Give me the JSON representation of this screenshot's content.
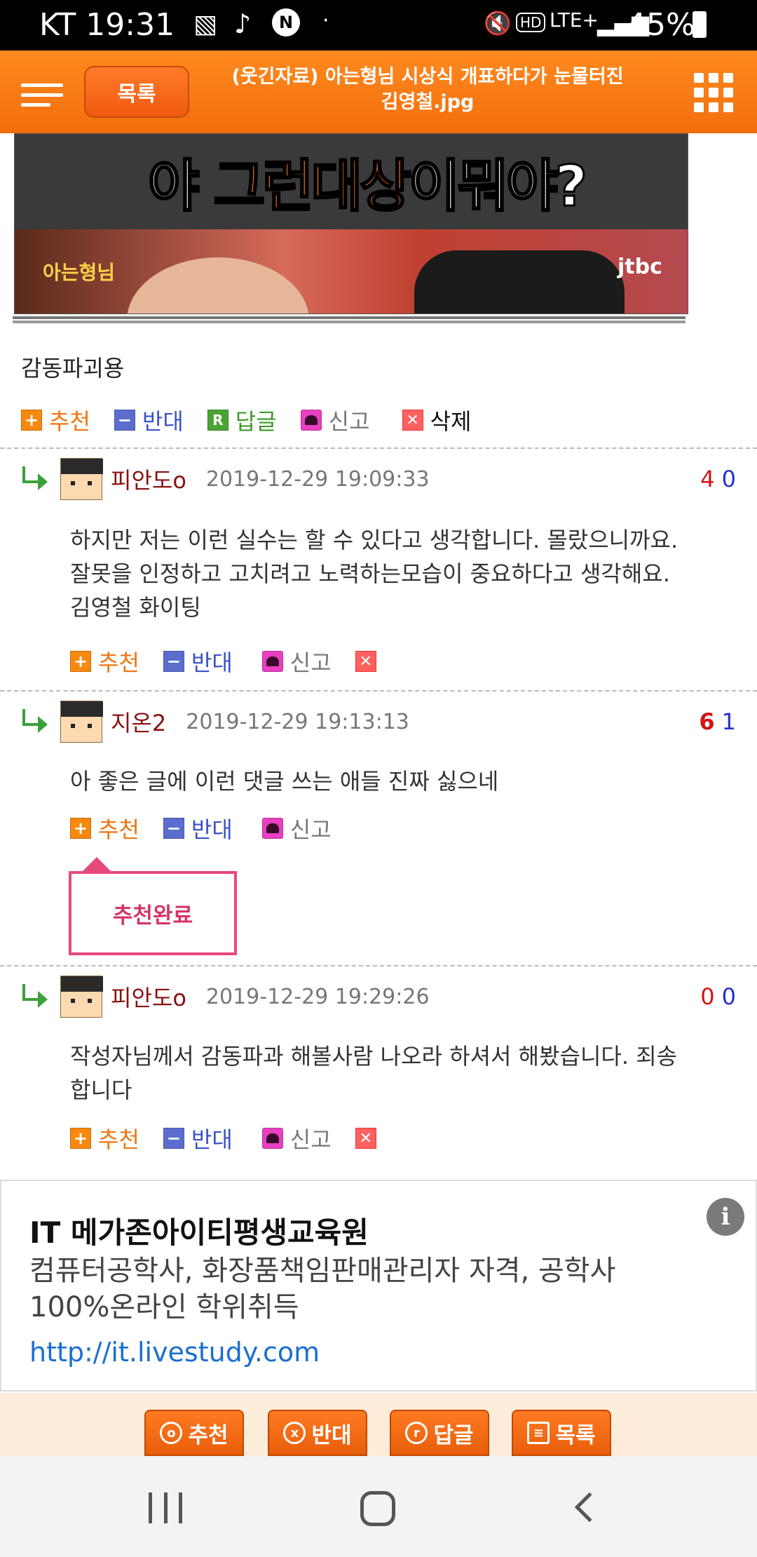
{
  "status_bar": {
    "carrier_time": "KT 19:31",
    "battery": "45%",
    "network": "LTE+"
  },
  "topbar": {
    "list_label": "목록",
    "title_line1": "(웃긴자료) 아는형님 시상식 개표하다가 눈물터진",
    "title_line2": "김영철.jpg"
  },
  "post_image": {
    "caption_left": "야 ",
    "caption_mid": "그런대상",
    "caption_right": "이뭐야?",
    "logo_left": "아는형님",
    "logo_right": "jtbc"
  },
  "post": {
    "text": "감동파괴용",
    "actions": {
      "recommend": "추천",
      "oppose": "반대",
      "reply": "답글",
      "report": "신고",
      "delete": "삭제"
    }
  },
  "comments": [
    {
      "nick": "피안도o",
      "date": "2019-12-29 19:09:33",
      "up": "4",
      "down": "0",
      "body": [
        "하지만 저는 이런 실수는 할 수 있다고 생각합니다. 몰랐으니까요.",
        "잘못을 인정하고 고치려고 노력하는모습이 중요하다고 생각해요.",
        "김영철 화이팅"
      ],
      "recommend": "추천",
      "oppose": "반대",
      "report": "신고"
    },
    {
      "nick": "지온2",
      "date": "2019-12-29 19:13:13",
      "up": "6",
      "down": "1",
      "body": [
        "아 좋은 글에 이런 댓글 쓰는 애들 진짜 싫으네"
      ],
      "recommend": "추천",
      "oppose": "반대",
      "report": "신고",
      "popup": "추천완료"
    },
    {
      "nick": "피안도o",
      "date": "2019-12-29 19:29:26",
      "up": "0",
      "down": "0",
      "body": [
        "작성자님께서 감동파과 해볼사람 나오라 하셔서 해봤습니다. 죄송",
        "합니다"
      ],
      "recommend": "추천",
      "oppose": "반대",
      "report": "신고"
    }
  ],
  "ad": {
    "title": "IT 메가존아이티평생교육원",
    "desc_line1": "컴퓨터공학사, 화장품책임판매관리자 자격, 공학사",
    "desc_line2": "100%온라인 학위취득",
    "url": "http://it.livestudy.com",
    "info_icon": "i"
  },
  "bottom_bar": {
    "recommend": "추천",
    "oppose": "반대",
    "reply": "답글",
    "list": "목록"
  },
  "colors": {
    "accent": "#f26e0d",
    "up_vote": "#d01515",
    "down_vote": "#2433c7",
    "popup": "#e64a7a"
  }
}
